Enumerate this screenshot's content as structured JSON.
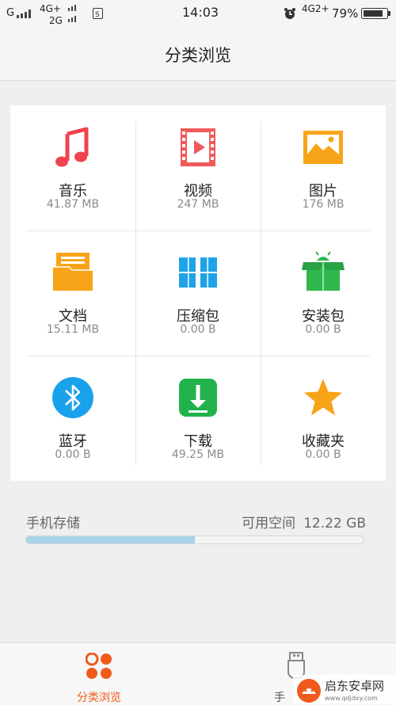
{
  "status_bar": {
    "signal_left": "G",
    "network_1": "4G+",
    "network_2": "2G",
    "time": "14:03",
    "network_right": "4G2+",
    "battery": "79%"
  },
  "header": {
    "title": "分类浏览"
  },
  "categories": [
    {
      "name": "音乐",
      "size": "41.87 MB",
      "icon": "music-note-icon",
      "color": "#f0424f"
    },
    {
      "name": "视频",
      "size": "247 MB",
      "icon": "video-film-icon",
      "color": "#f05a5a"
    },
    {
      "name": "图片",
      "size": "176 MB",
      "icon": "picture-icon",
      "color": "#f8a418"
    },
    {
      "name": "文档",
      "size": "15.11 MB",
      "icon": "folder-document-icon",
      "color": "#f8a418"
    },
    {
      "name": "压缩包",
      "size": "0.00 B",
      "icon": "archive-icon",
      "color": "#1ea3e8"
    },
    {
      "name": "安装包",
      "size": "0.00 B",
      "icon": "android-package-icon",
      "color": "#2fb84e"
    },
    {
      "name": "蓝牙",
      "size": "0.00 B",
      "icon": "bluetooth-icon",
      "color": "#1aa1ec"
    },
    {
      "name": "下载",
      "size": "49.25 MB",
      "icon": "download-icon",
      "color": "#22b24c"
    },
    {
      "name": "收藏夹",
      "size": "0.00 B",
      "icon": "star-icon",
      "color": "#f8a418"
    }
  ],
  "storage": {
    "label": "手机存储",
    "available_label": "可用空间",
    "available_value": "12.22 GB",
    "used_fraction": 0.5
  },
  "bottom_nav": {
    "tabs": [
      {
        "label": "分类浏览",
        "icon": "category-grid-icon",
        "active": true,
        "color": "#f05a1c"
      },
      {
        "label": "手",
        "icon": "phone-storage-icon",
        "active": false
      }
    ]
  },
  "watermark": {
    "text": "启东安卓网",
    "url_text": "www.qdjdxy.com"
  }
}
